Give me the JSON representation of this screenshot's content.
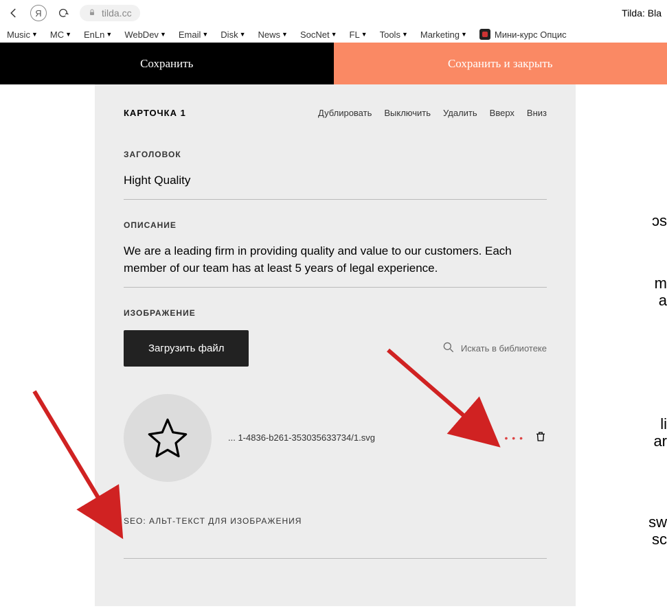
{
  "browser": {
    "url": "tilda.cc",
    "page_title": "Tilda: Bla"
  },
  "bookmarks": [
    {
      "label": "Music"
    },
    {
      "label": "MC"
    },
    {
      "label": "EnLn"
    },
    {
      "label": "WebDev"
    },
    {
      "label": "Email"
    },
    {
      "label": "Disk"
    },
    {
      "label": "News"
    },
    {
      "label": "SocNet"
    },
    {
      "label": "FL"
    },
    {
      "label": "Tools"
    },
    {
      "label": "Marketing"
    }
  ],
  "bookmark_extra": "Мини-курс Опцис",
  "actions": {
    "save": "Сохранить",
    "save_close": "Сохранить и закрыть"
  },
  "card": {
    "title": "КАРТОЧКА 1",
    "ops": {
      "duplicate": "Дублировать",
      "disable": "Выключить",
      "delete": "Удалить",
      "up": "Вверх",
      "down": "Вниз"
    }
  },
  "fields": {
    "heading_label": "ЗАГОЛОВОК",
    "heading_value": "Hight Quality",
    "desc_label": "ОПИСАНИЕ",
    "desc_value": "We are a leading firm in providing quality and value to our customers. Each member of our team has at least 5 years of legal experience.",
    "image_label": "ИЗОБРАЖЕНИЕ",
    "upload_btn": "Загрузить файл",
    "lib_search": "Искать в библиотеке",
    "file_name": "... 1-4836-b261-353035633734/1.svg",
    "alt_label": "SEO: АЛЬТ-ТЕКСТ ДЛЯ ИЗОБРАЖЕНИЯ"
  },
  "side_fragments": {
    "a": "ɔs",
    "b": "m",
    "c": "a",
    "d": "li",
    "e": "ar",
    "f": "sw",
    "g": "sc"
  }
}
